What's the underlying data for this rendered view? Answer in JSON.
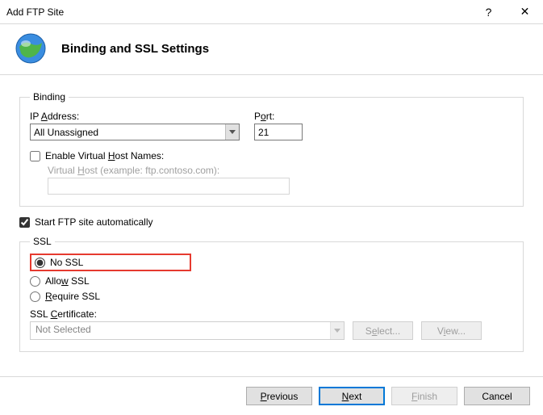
{
  "window": {
    "title": "Add FTP Site",
    "help": "?",
    "close": "✕"
  },
  "header": {
    "title": "Binding and SSL Settings"
  },
  "binding": {
    "legend": "Binding",
    "ip_label_pre": "IP ",
    "ip_label_u": "A",
    "ip_label_post": "ddress:",
    "ip_value": "All Unassigned",
    "port_label_pre": "P",
    "port_label_u": "o",
    "port_label_post": "rt:",
    "port_value": "21",
    "vhosts_label_pre": "Enable Virtual ",
    "vhosts_label_u": "H",
    "vhosts_label_post": "ost Names:",
    "vhost_hint_pre": "Virtual ",
    "vhost_hint_u": "H",
    "vhost_hint_post": "ost (example: ftp.contoso.com):"
  },
  "auto": {
    "label": "Start FTP site automatically"
  },
  "ssl": {
    "legend": "SSL",
    "no_ssl": "No SSL",
    "allow_pre": "Allo",
    "allow_u": "w",
    "allow_post": " SSL",
    "require_u": "R",
    "require_post": "equire SSL",
    "cert_label_pre": "SSL ",
    "cert_label_u": "C",
    "cert_label_post": "ertificate:",
    "cert_value": "Not Selected",
    "select_btn_pre": "S",
    "select_btn_u": "e",
    "select_btn_post": "lect...",
    "view_btn_pre": "V",
    "view_btn_u": "i",
    "view_btn_post": "ew..."
  },
  "footer": {
    "prev_u": "P",
    "prev_post": "revious",
    "next_u": "N",
    "next_post": "ext",
    "finish_u": "F",
    "finish_post": "inish",
    "cancel": "Cancel"
  }
}
